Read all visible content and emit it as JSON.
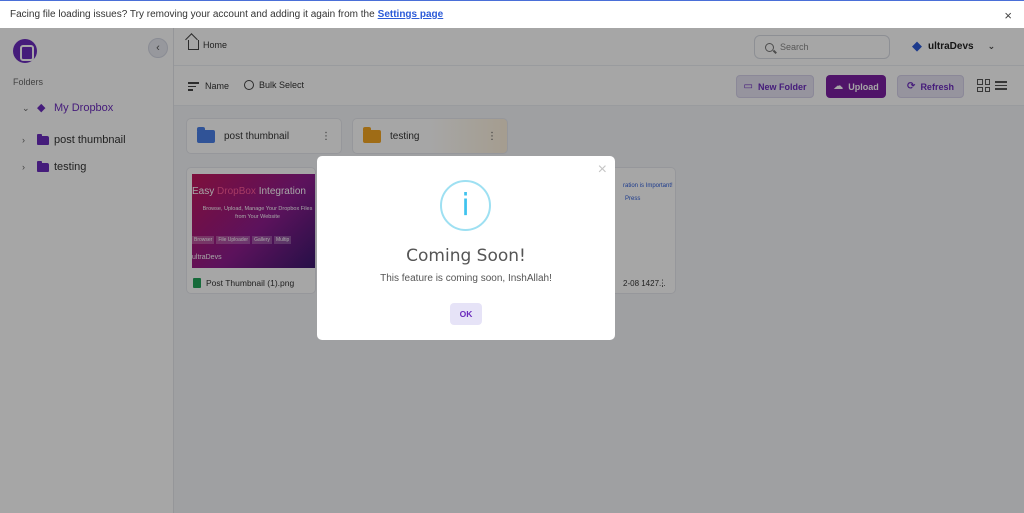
{
  "notice": {
    "text": "Facing file loading issues? Try removing your account and adding it again from the",
    "link": "Settings page",
    "close": "×"
  },
  "sidebar": {
    "folders_label": "Folders",
    "collapse": "‹",
    "tree": [
      {
        "label": "My Dropbox",
        "icon": "dropbox-icon",
        "expanded": true
      },
      {
        "label": "post thumbnail",
        "icon": "folder-icon",
        "expanded": false
      },
      {
        "label": "testing",
        "icon": "folder-icon",
        "expanded": false
      }
    ]
  },
  "header": {
    "breadcrumb_home": "Home",
    "search_placeholder": "Search",
    "user_name": "ultraDevs"
  },
  "toolbar": {
    "sort_label": "Name",
    "bulk_label": "Bulk Select",
    "new_folder": "New Folder",
    "upload": "Upload",
    "refresh": "Refresh"
  },
  "content": {
    "folders": [
      {
        "name": "post thumbnail",
        "color": "#4a80e8"
      },
      {
        "name": "testing",
        "color": "#f5a623"
      }
    ],
    "files": [
      {
        "name": "Post Thumbnail (1).png",
        "thumb": {
          "title_pre": "Easy",
          "title_accent": "DropBox",
          "title_post": "Integration",
          "subtitle": "Browse, Upload, Manage Your Dropbox Files from Your Website",
          "tags": [
            "Browser",
            "File Uploader",
            "Gallery",
            "Multip"
          ],
          "brand": "ultraDevs"
        }
      },
      {
        "name": "2-08 1427...",
        "snippet1": "ration is Important!",
        "snippet2": "Press"
      }
    ]
  },
  "modal": {
    "close": "×",
    "icon": "i",
    "title": "Coming Soon!",
    "message": "This feature is coming soon, InshAllah!",
    "ok": "OK"
  },
  "colors": {
    "brand": "#6b2bbd",
    "upload": "#7b1fa2",
    "info": "#3fc3ee"
  }
}
